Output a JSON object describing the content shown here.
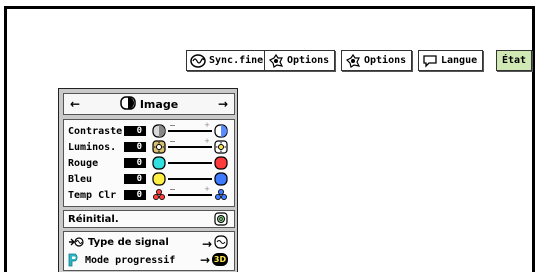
{
  "tabs": [
    {
      "label": "Sync.fine",
      "icon": "sync-fine-icon",
      "active": false
    },
    {
      "label": "Options",
      "icon": "options-icon",
      "active": false
    },
    {
      "label": "Options",
      "icon": "options-icon",
      "active": false
    },
    {
      "label": "Langue",
      "icon": "speech-bubble-icon",
      "active": false
    },
    {
      "label": "État",
      "icon": "",
      "active": true
    }
  ],
  "panel": {
    "title": "Image",
    "title_icon": "image-icon",
    "nav_left": "←",
    "nav_right": "→"
  },
  "adjustments": [
    {
      "label": "Contraste",
      "value": "0",
      "left_icon": "contrast-low-icon",
      "right_icon": "contrast-high-icon"
    },
    {
      "label": "Luminos.",
      "value": "0",
      "left_icon": "brightness-low-icon",
      "right_icon": "brightness-high-icon"
    },
    {
      "label": "Rouge",
      "value": "0",
      "left_icon": "cyan-circle-icon",
      "right_icon": "red-circle-icon"
    },
    {
      "label": "Bleu",
      "value": "0",
      "left_icon": "yellow-circle-icon",
      "right_icon": "blue-circle-icon"
    },
    {
      "label": "Temp Clr",
      "value": "0",
      "left_icon": "color-temp-warm-icon",
      "right_icon": "color-temp-cool-icon"
    }
  ],
  "reset": {
    "label": "Réinitial.",
    "icon": "reset-icon"
  },
  "signal": {
    "label": "Type de signal",
    "arrow": "→"
  },
  "progressive": {
    "label": "Mode progressif",
    "arrow": "→",
    "badge": "3D"
  },
  "colors": {
    "panel_bg": "#c9c9c9",
    "active_tab": "#cfe8b4",
    "red": "#ff3b3b",
    "cyan": "#33e0e0",
    "yellow": "#ffee44",
    "blue": "#3f7bff"
  }
}
